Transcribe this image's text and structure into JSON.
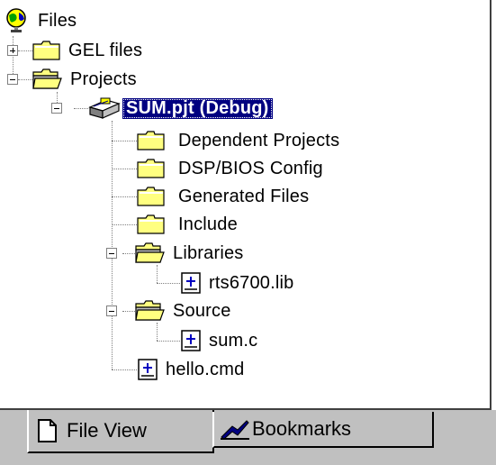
{
  "tree": {
    "root": {
      "label": "Files",
      "icon": "globe-icon"
    },
    "items": [
      {
        "label": "GEL files",
        "icon": "folder-icon",
        "expander": "plus"
      },
      {
        "label": "Projects",
        "icon": "open-folder-icon",
        "expander": "minus"
      },
      {
        "label": "SUM.pjt (Debug)",
        "icon": "project-icon",
        "expander": "minus",
        "selected": true
      },
      {
        "label": "Dependent Projects",
        "icon": "folder-icon"
      },
      {
        "label": "DSP/BIOS Config",
        "icon": "folder-icon"
      },
      {
        "label": "Generated Files",
        "icon": "folder-icon"
      },
      {
        "label": "Include",
        "icon": "folder-icon"
      },
      {
        "label": "Libraries",
        "icon": "open-folder-icon",
        "expander": "minus"
      },
      {
        "label": "rts6700.lib",
        "icon": "file-icon"
      },
      {
        "label": "Source",
        "icon": "open-folder-icon",
        "expander": "minus"
      },
      {
        "label": "sum.c",
        "icon": "file-icon"
      },
      {
        "label": "hello.cmd",
        "icon": "file-icon"
      }
    ]
  },
  "tabs": [
    {
      "label": "File View",
      "icon": "document-icon",
      "active": true
    },
    {
      "label": "Bookmarks",
      "icon": "bookmark-icon",
      "active": false
    }
  ],
  "colors": {
    "selection": "#000080",
    "folder": "#ffff80",
    "panel": "#c0c0c0"
  }
}
